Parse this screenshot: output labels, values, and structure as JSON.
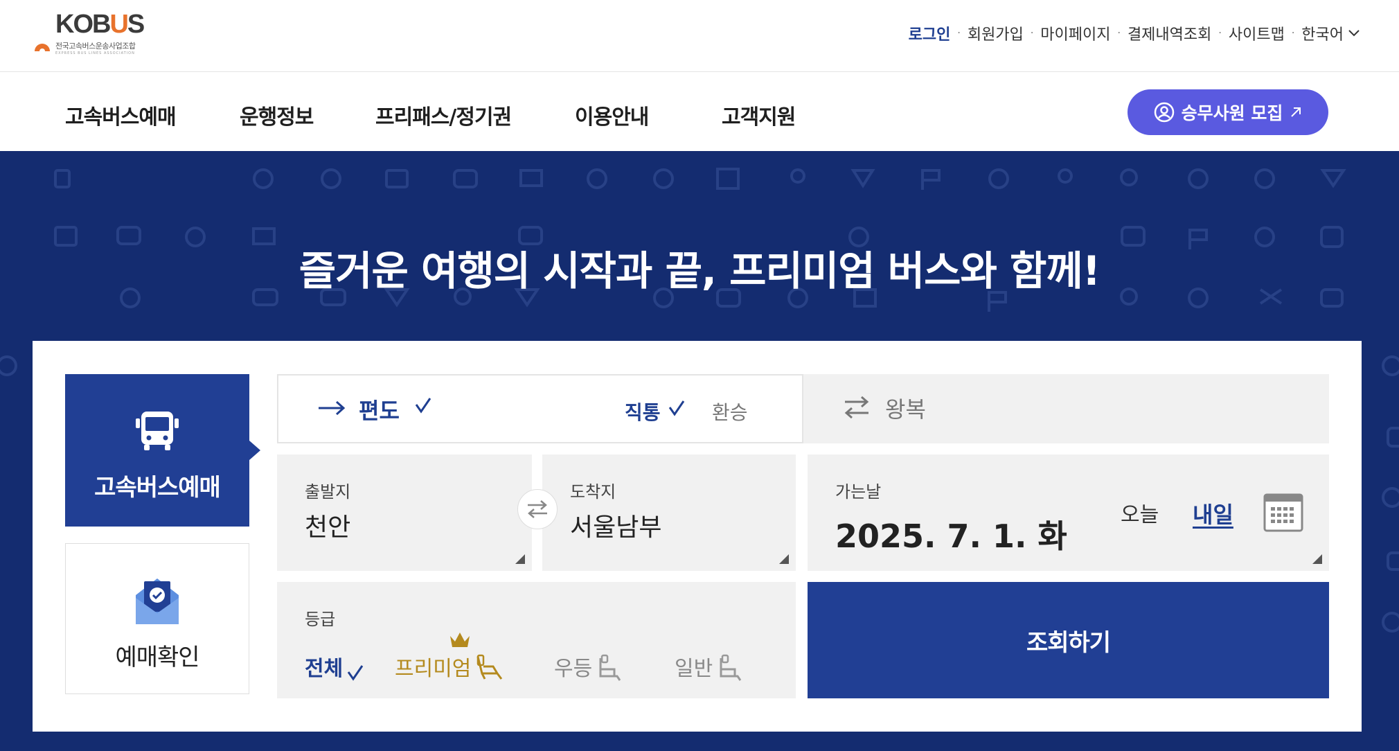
{
  "logo": {
    "wordmark_a": "KO",
    "wordmark_b": "B",
    "wordmark_u": "U",
    "wordmark_c": "S",
    "subtitle": "전국고속버스운송사업조합",
    "subtitle_en": "EXPRESS BUS LINES ASSOCIATION"
  },
  "util_menu": {
    "login": "로그인",
    "signup": "회원가입",
    "mypage": "마이페이지",
    "payment_history": "결제내역조회",
    "sitemap": "사이트맵",
    "language": "한국어",
    "separator": "·"
  },
  "gnb": {
    "items": [
      "고속버스예매",
      "운행정보",
      "프리패스/정기권",
      "이용안내",
      "고객지원"
    ],
    "recruit_label": "승무사원 모집"
  },
  "hero": {
    "title": "즐거운 여행의 시작과 끝, 프리미엄 버스와 함께!"
  },
  "side_tabs": {
    "booking": "고속버스예매",
    "confirm": "예매확인"
  },
  "trip": {
    "oneway": "편도",
    "direct": "직통",
    "transfer": "환승",
    "roundtrip": "왕복"
  },
  "fields": {
    "departure_label": "출발지",
    "departure_value": "천안",
    "arrival_label": "도착지",
    "arrival_value": "서울남부",
    "date_label": "가는날",
    "date_value": "2025. 7. 1. 화",
    "today": "오늘",
    "tomorrow": "내일",
    "grade_label": "등급"
  },
  "grades": {
    "all": "전체",
    "premium": "프리미엄",
    "udeung": "우등",
    "normal": "일반"
  },
  "search_label": "조회하기",
  "colors": {
    "navy": "#142c70",
    "primary": "#213f94",
    "recruit": "#5a5ae0",
    "premium_gold": "#b48a1e",
    "logo_orange": "#e8722c"
  },
  "icons": [
    "bus-icon",
    "mail-check-icon",
    "arrow-right-icon",
    "check-icon",
    "swap-icon",
    "calendar-icon",
    "crown-icon",
    "seat-icon",
    "person-icon",
    "chevron-down-icon",
    "external-arrow-icon"
  ]
}
